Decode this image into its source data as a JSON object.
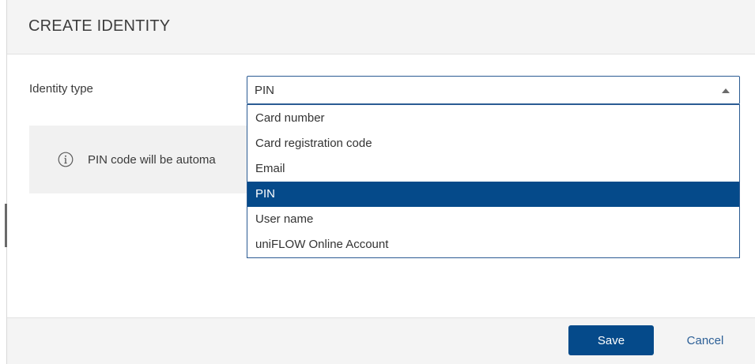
{
  "dialog": {
    "title": "CREATE IDENTITY"
  },
  "form": {
    "identity_type_label": "Identity type",
    "identity_type_value": "PIN"
  },
  "info": {
    "icon": "info-circle-icon",
    "text": "PIN code will be automa"
  },
  "dropdown": {
    "options": [
      {
        "label": "Card number",
        "selected": false
      },
      {
        "label": "Card registration code",
        "selected": false
      },
      {
        "label": "Email",
        "selected": false
      },
      {
        "label": "PIN",
        "selected": true
      },
      {
        "label": "User name",
        "selected": false
      },
      {
        "label": "uniFLOW Online Account",
        "selected": false
      }
    ]
  },
  "footer": {
    "save_label": "Save",
    "cancel_label": "Cancel"
  },
  "colors": {
    "accent": "#054a8a",
    "link": "#2c5f96",
    "header_bg": "#f4f4f4",
    "info_bg": "#f1f1f1"
  }
}
